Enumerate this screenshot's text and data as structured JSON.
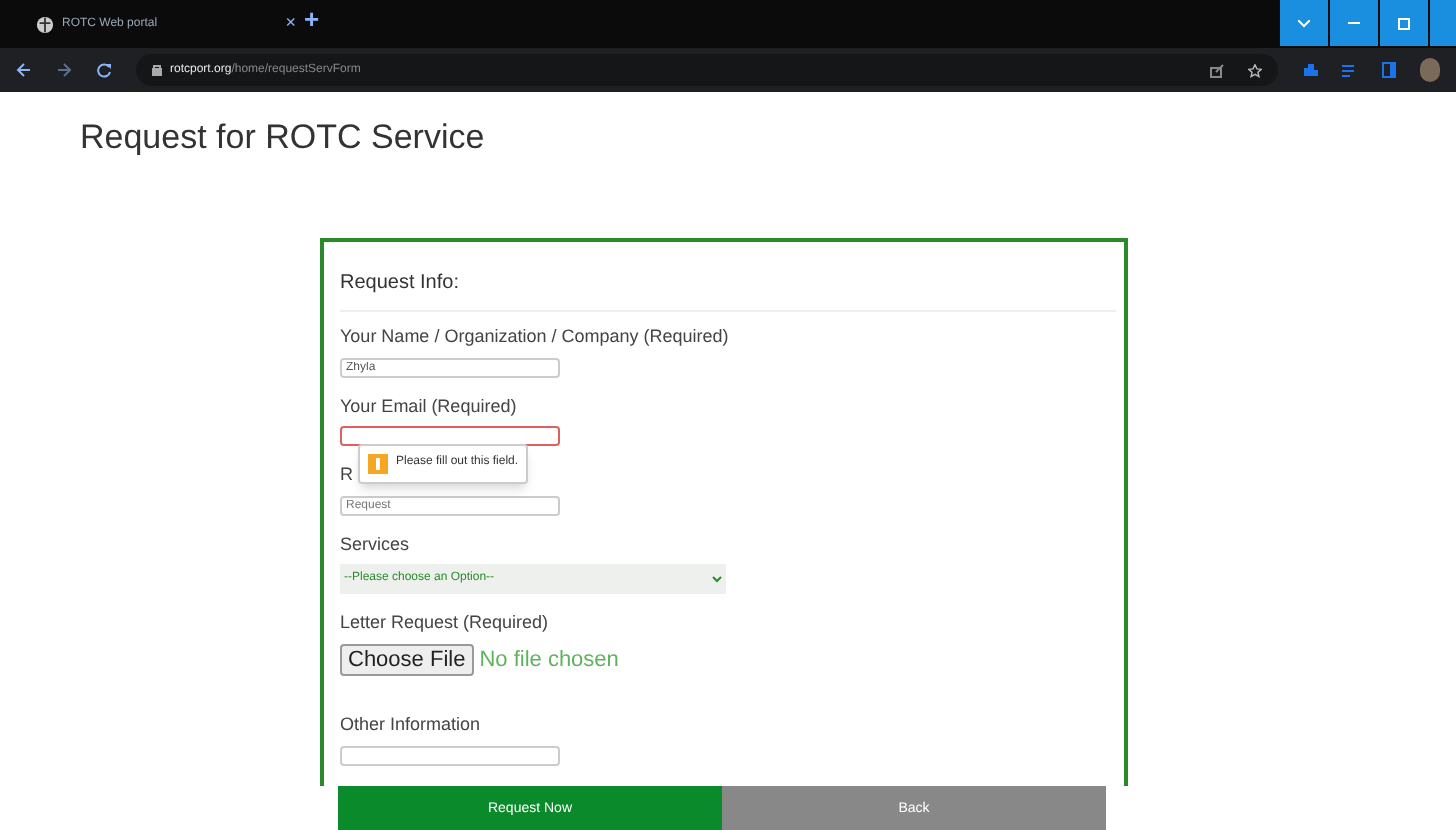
{
  "browser": {
    "tab_title": "ROTC Web portal",
    "tab_close": "×",
    "new_tab": "+",
    "url_host": "rotcport.org",
    "url_path": "/home/requestServForm"
  },
  "page_title": "Request for ROTC Service",
  "form": {
    "heading": "Request Info:",
    "fields": [
      {
        "kind": "text",
        "label": "Your Name / Organization / Company (Required)",
        "value": "Zhyla",
        "invalid": false
      },
      {
        "kind": "text",
        "label": "Your Email (Required)",
        "invalid": true,
        "tooltip": "Please fill out this field."
      },
      {
        "kind": "text",
        "label": "R",
        "placeholder": "Request",
        "invalid": false
      },
      {
        "kind": "select",
        "label": "Services",
        "value": "--Please choose an Option--"
      },
      {
        "kind": "file",
        "label": "Letter Request (Required)",
        "button": "Choose File",
        "status": "No file chosen"
      },
      {
        "kind": "text",
        "label": "Other Information",
        "invalid": false
      }
    ]
  },
  "buttons": [
    {
      "label": "Request Now",
      "kind": "primary"
    },
    {
      "label": "Back",
      "kind": "secondary"
    }
  ]
}
